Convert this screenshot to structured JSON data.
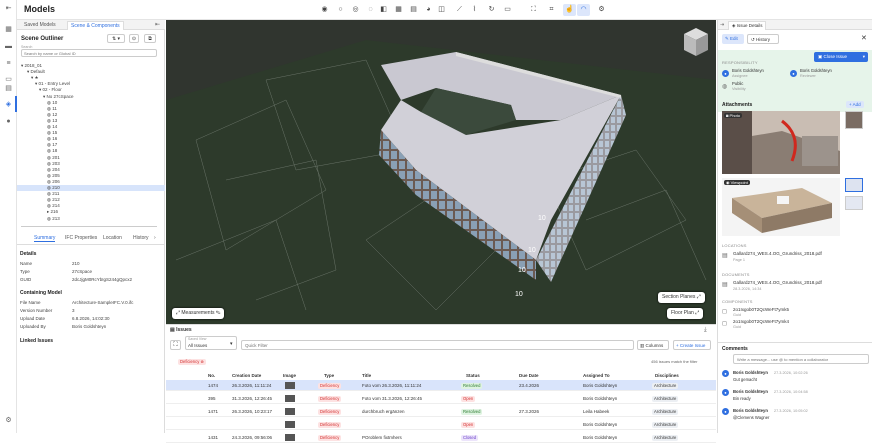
{
  "app": {
    "title": "Models"
  },
  "left_panel": {
    "tabs": [
      "Saved Models",
      "Scene & Components"
    ],
    "outliner_title": "Scene Outliner",
    "search_label": "Search",
    "search_placeholder": "Search by name or Global ID",
    "tree": [
      "2018_01",
      "Default",
      "★",
      "01 - Entry Level",
      "02 - Floor",
      "No 27cSpace",
      "10",
      "11",
      "12",
      "13",
      "14",
      "15",
      "16",
      "17",
      "18",
      "201",
      "203",
      "204",
      "205",
      "206",
      "210",
      "211",
      "212",
      "214",
      "216",
      "213"
    ],
    "subtabs": [
      "Summary",
      "IFC Properties",
      "Location",
      "History"
    ],
    "details_title": "Details",
    "details": [
      {
        "k": "Name",
        "v": "210"
      },
      {
        "k": "Type",
        "v": "27cSpace"
      },
      {
        "k": "GUID",
        "v": "2dcJjgM0RcYbIgS244gQpcx2"
      }
    ],
    "containing_title": "Containing Model",
    "containing": [
      {
        "k": "File Name",
        "v": "Architecture-SampleIFC.V.0.ifc"
      },
      {
        "k": "Version Number",
        "v": "3"
      },
      {
        "k": "Upload Date",
        "v": "6.8.2026, 14:02:30"
      },
      {
        "k": "Uploaded By",
        "v": "Boris Goldshteyn"
      }
    ],
    "linked_title": "Linked Issues"
  },
  "viewport": {
    "measurements": "Measurements",
    "section_planes": "Section Planes",
    "floor_plan": "Floor Plan",
    "grid_labels": [
      "10",
      "10",
      "10",
      "10"
    ]
  },
  "issues": {
    "panel_title": "Issues",
    "saved_view_label": "Saved View",
    "saved_view_value": "All Issues",
    "quick_filter_placeholder": "Quick Filter",
    "columns_btn": "Columns",
    "create_btn": "Create Issue",
    "match_text": "456 issues match the filter",
    "filter_chip": "Deficiency",
    "headers": [
      "No.",
      "Creation Date",
      "Image",
      "Type",
      "Title",
      "Status",
      "Due Date",
      "Assigned To",
      "Disciplines"
    ],
    "rows": [
      {
        "no": "1474",
        "date": "26.3.2026, 11:11:24",
        "type": "Deficiency",
        "title": "Foto vom 26.3.2026, 11:11:24",
        "status": "Resolved",
        "due": "23.4.2026",
        "assigned": "Boris Goldshteyn",
        "disc": "Architecture"
      },
      {
        "no": "395",
        "date": "31.3.2026, 12:26:45",
        "type": "Deficiency",
        "title": "Foto vom 31.3.2026, 12:26:45",
        "status": "Open",
        "due": "",
        "assigned": "Boris Goldshteyn",
        "disc": "Architecture"
      },
      {
        "no": "1471",
        "date": "26.3.2026, 10:23:17",
        "type": "Deficiency",
        "title": "durchbruch ergänzen",
        "status": "Resolved",
        "due": "27.3.2026",
        "assigned": "Leila Habeek",
        "disc": "Architecture"
      },
      {
        "no": "",
        "date": "",
        "type": "Deficiency",
        "title": "",
        "status": "Open",
        "due": "",
        "assigned": "Boris Goldshteyn",
        "disc": "Architecture"
      },
      {
        "no": "1431",
        "date": "24.3.2026, 09:56:06",
        "type": "Deficiency",
        "title": "POroblem fixtmhers",
        "status": "Closed",
        "due": "",
        "assigned": "Boris Goldshteyn",
        "disc": "Architecture"
      }
    ]
  },
  "right_panel": {
    "tab": "Issue Details",
    "edit_btn": "Edit",
    "history_btn": "History",
    "close_issue_btn": "Close Issue",
    "responsibility_label": "RESPONSIBILITY",
    "people": [
      {
        "name": "Boris Goldshteyn",
        "role": "Assignee"
      },
      {
        "name": "Boris Goldshteyn",
        "role": "Reviewer"
      }
    ],
    "visibility": {
      "name": "Public",
      "role": "Visibility"
    },
    "attachments_title": "Attachments",
    "add_btn": "Add",
    "photo_label": "Photo",
    "viewpoint_label": "Viewpoint",
    "locations_label": "LOCATIONS",
    "location_file": "Gallard274_WES.4.OG_Grundriss_2018.pdf",
    "location_sub": "Page 1",
    "documents_label": "DOCUMENTS",
    "document_file": "Gallard274_WES.4.OG_Grundriss_2018.pdf",
    "document_sub": "28.3.2026, 14:34",
    "components_label": "COMPONENTS",
    "components": [
      {
        "name": "2o1Ixgob0T2QcWeFt7ymk5",
        "sub": "Guid"
      },
      {
        "name": "2o1Ixgob0T2QcWeFt7ymk4",
        "sub": "Guid"
      }
    ],
    "comments_title": "Comments",
    "comment_placeholder": "Write a message... use @ to mention a collaborator",
    "comments": [
      {
        "author": "Boris Goldshteyn",
        "time": "27.3.2026, 10:02:26",
        "text": "Gut gemacht"
      },
      {
        "author": "Boris Goldshteyn",
        "time": "27.3.2026, 10:04:58",
        "text": "Bin ready"
      },
      {
        "author": "Boris Goldshteyn",
        "time": "27.3.2026, 10:05:02",
        "text": "@Clemens Wagner"
      }
    ]
  },
  "colors": {
    "accent": "#2f6fe0",
    "viewport_bg": "#2f342f",
    "selected_row": "#d9e4fb"
  }
}
